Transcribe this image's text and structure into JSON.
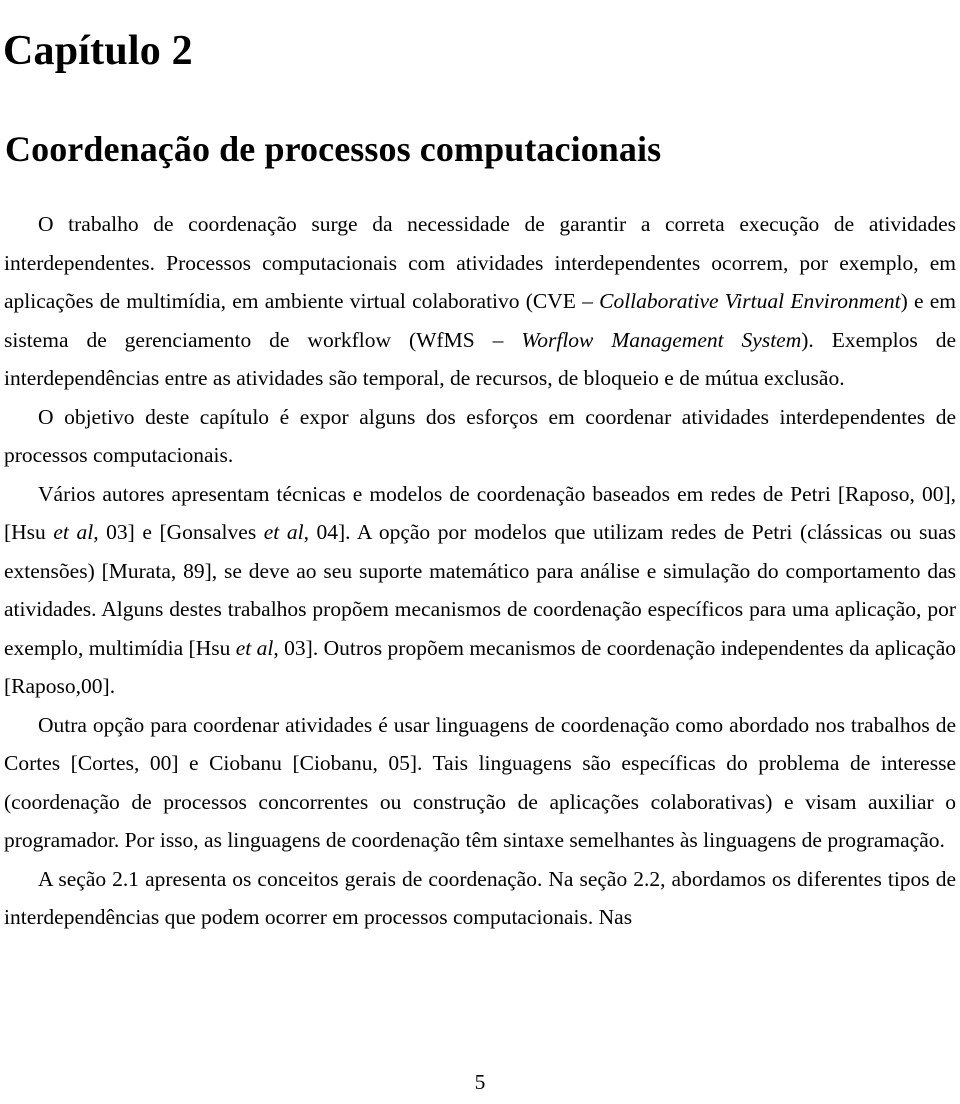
{
  "document": {
    "chapter_label": "Capítulo 2",
    "chapter_title": "Coordenação de processos computacionais",
    "page_number": "5"
  },
  "paragraphs": [
    {
      "id": "p1",
      "runs": [
        {
          "text": "O trabalho de coordenação surge da necessidade de garantir a correta execução de atividades interdependentes. Processos computacionais com atividades interdependentes ocorrem, por exemplo, em aplicações de multimídia, em ambiente virtual colaborativo (CVE – ",
          "style": "normal"
        },
        {
          "text": "Collaborative Virtual Environment",
          "style": "italic"
        },
        {
          "text": ") e em sistema de gerenciamento de workflow (WfMS – ",
          "style": "normal"
        },
        {
          "text": "Worflow Management System",
          "style": "italic"
        },
        {
          "text": "). Exemplos de interdependências entre as atividades são temporal, de recursos, de bloqueio e de mútua exclusão.",
          "style": "normal"
        }
      ]
    },
    {
      "id": "p2",
      "runs": [
        {
          "text": "O objetivo deste capítulo é expor alguns dos esforços em coordenar atividades interdependentes de processos computacionais.",
          "style": "normal"
        }
      ]
    },
    {
      "id": "p3",
      "runs": [
        {
          "text": "Vários autores apresentam técnicas e modelos de coordenação baseados em redes de Petri [Raposo, 00], [Hsu ",
          "style": "normal"
        },
        {
          "text": "et al",
          "style": "italic"
        },
        {
          "text": ", 03] e [Gonsalves ",
          "style": "normal"
        },
        {
          "text": "et al",
          "style": "italic"
        },
        {
          "text": ", 04]. A opção por modelos que utilizam redes de Petri (clássicas ou suas extensões) [Murata, 89], se deve ao seu suporte matemático para análise e simulação do comportamento das atividades. Alguns destes trabalhos propõem mecanismos de coordenação específicos para uma aplicação, por exemplo, multimídia [Hsu ",
          "style": "normal"
        },
        {
          "text": "et al",
          "style": "italic"
        },
        {
          "text": ", 03]. Outros propõem mecanismos de coordenação independentes da aplicação [Raposo,00].",
          "style": "normal"
        }
      ]
    },
    {
      "id": "p4",
      "runs": [
        {
          "text": "Outra opção para coordenar atividades é usar linguagens de coordenação como abordado nos trabalhos de Cortes [Cortes, 00] e Ciobanu [Ciobanu, 05]. Tais linguagens são específicas do problema de interesse (coordenação de processos concorrentes ou construção de aplicações colaborativas) e visam auxiliar o programador. Por isso, as linguagens de coordenação têm sintaxe semelhantes às linguagens de programação.",
          "style": "normal"
        }
      ]
    },
    {
      "id": "p5",
      "runs": [
        {
          "text": "A seção 2.1 apresenta os conceitos gerais de coordenação. Na seção 2.2, abordamos os diferentes tipos de interdependências que podem ocorrer em processos computacionais. Nas",
          "style": "normal"
        }
      ]
    }
  ]
}
